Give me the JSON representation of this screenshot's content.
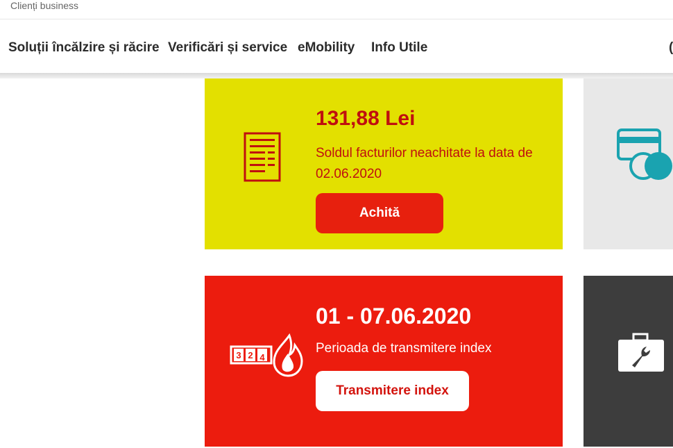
{
  "topbar": {
    "business_label": "Clienți business"
  },
  "nav": {
    "items": [
      {
        "label": "Soluții încălzire și răcire"
      },
      {
        "label": "Verificări și service"
      },
      {
        "label": "eMobility"
      },
      {
        "label": "Info Utile"
      }
    ]
  },
  "invoice_tile": {
    "amount": "131,88 Lei",
    "description": "Soldul facturilor neachitate la data de 02.06.2020",
    "pay_button": "Achită",
    "icon": "invoice-document-icon"
  },
  "index_tile": {
    "period": "01 - 07.06.2020",
    "label": "Perioada de transmitere index",
    "button": "Transmitere index",
    "icon": "gas-meter-flame-icon",
    "meter_digits": [
      "3",
      "2",
      "4"
    ]
  },
  "side_tiles": [
    {
      "icon": "card-coins-icon"
    },
    {
      "icon": "toolbox-wrench-icon"
    }
  ],
  "colors": {
    "yellow_tile": "#e3e000",
    "red_tile": "#ec1c0e",
    "brand_red": "#bf0f0f",
    "grey_tile": "#e8e8e8",
    "dark_tile": "#3d3d3d",
    "teal_icon": "#1aa3b0"
  }
}
